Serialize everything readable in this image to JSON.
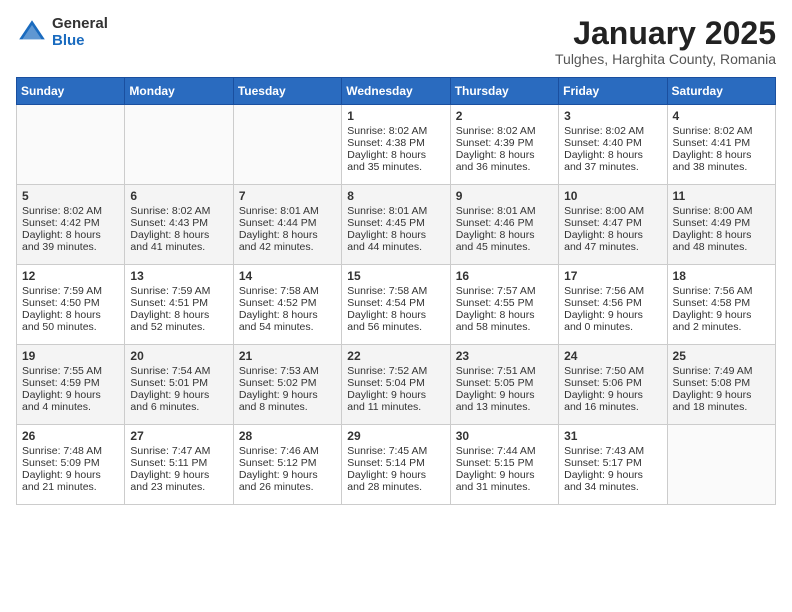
{
  "header": {
    "logo_general": "General",
    "logo_blue": "Blue",
    "title": "January 2025",
    "subtitle": "Tulghes, Harghita County, Romania"
  },
  "days_of_week": [
    "Sunday",
    "Monday",
    "Tuesday",
    "Wednesday",
    "Thursday",
    "Friday",
    "Saturday"
  ],
  "weeks": [
    [
      {
        "day": "",
        "content": ""
      },
      {
        "day": "",
        "content": ""
      },
      {
        "day": "",
        "content": ""
      },
      {
        "day": "1",
        "content": "Sunrise: 8:02 AM\nSunset: 4:38 PM\nDaylight: 8 hours and 35 minutes."
      },
      {
        "day": "2",
        "content": "Sunrise: 8:02 AM\nSunset: 4:39 PM\nDaylight: 8 hours and 36 minutes."
      },
      {
        "day": "3",
        "content": "Sunrise: 8:02 AM\nSunset: 4:40 PM\nDaylight: 8 hours and 37 minutes."
      },
      {
        "day": "4",
        "content": "Sunrise: 8:02 AM\nSunset: 4:41 PM\nDaylight: 8 hours and 38 minutes."
      }
    ],
    [
      {
        "day": "5",
        "content": "Sunrise: 8:02 AM\nSunset: 4:42 PM\nDaylight: 8 hours and 39 minutes."
      },
      {
        "day": "6",
        "content": "Sunrise: 8:02 AM\nSunset: 4:43 PM\nDaylight: 8 hours and 41 minutes."
      },
      {
        "day": "7",
        "content": "Sunrise: 8:01 AM\nSunset: 4:44 PM\nDaylight: 8 hours and 42 minutes."
      },
      {
        "day": "8",
        "content": "Sunrise: 8:01 AM\nSunset: 4:45 PM\nDaylight: 8 hours and 44 minutes."
      },
      {
        "day": "9",
        "content": "Sunrise: 8:01 AM\nSunset: 4:46 PM\nDaylight: 8 hours and 45 minutes."
      },
      {
        "day": "10",
        "content": "Sunrise: 8:00 AM\nSunset: 4:47 PM\nDaylight: 8 hours and 47 minutes."
      },
      {
        "day": "11",
        "content": "Sunrise: 8:00 AM\nSunset: 4:49 PM\nDaylight: 8 hours and 48 minutes."
      }
    ],
    [
      {
        "day": "12",
        "content": "Sunrise: 7:59 AM\nSunset: 4:50 PM\nDaylight: 8 hours and 50 minutes."
      },
      {
        "day": "13",
        "content": "Sunrise: 7:59 AM\nSunset: 4:51 PM\nDaylight: 8 hours and 52 minutes."
      },
      {
        "day": "14",
        "content": "Sunrise: 7:58 AM\nSunset: 4:52 PM\nDaylight: 8 hours and 54 minutes."
      },
      {
        "day": "15",
        "content": "Sunrise: 7:58 AM\nSunset: 4:54 PM\nDaylight: 8 hours and 56 minutes."
      },
      {
        "day": "16",
        "content": "Sunrise: 7:57 AM\nSunset: 4:55 PM\nDaylight: 8 hours and 58 minutes."
      },
      {
        "day": "17",
        "content": "Sunrise: 7:56 AM\nSunset: 4:56 PM\nDaylight: 9 hours and 0 minutes."
      },
      {
        "day": "18",
        "content": "Sunrise: 7:56 AM\nSunset: 4:58 PM\nDaylight: 9 hours and 2 minutes."
      }
    ],
    [
      {
        "day": "19",
        "content": "Sunrise: 7:55 AM\nSunset: 4:59 PM\nDaylight: 9 hours and 4 minutes."
      },
      {
        "day": "20",
        "content": "Sunrise: 7:54 AM\nSunset: 5:01 PM\nDaylight: 9 hours and 6 minutes."
      },
      {
        "day": "21",
        "content": "Sunrise: 7:53 AM\nSunset: 5:02 PM\nDaylight: 9 hours and 8 minutes."
      },
      {
        "day": "22",
        "content": "Sunrise: 7:52 AM\nSunset: 5:04 PM\nDaylight: 9 hours and 11 minutes."
      },
      {
        "day": "23",
        "content": "Sunrise: 7:51 AM\nSunset: 5:05 PM\nDaylight: 9 hours and 13 minutes."
      },
      {
        "day": "24",
        "content": "Sunrise: 7:50 AM\nSunset: 5:06 PM\nDaylight: 9 hours and 16 minutes."
      },
      {
        "day": "25",
        "content": "Sunrise: 7:49 AM\nSunset: 5:08 PM\nDaylight: 9 hours and 18 minutes."
      }
    ],
    [
      {
        "day": "26",
        "content": "Sunrise: 7:48 AM\nSunset: 5:09 PM\nDaylight: 9 hours and 21 minutes."
      },
      {
        "day": "27",
        "content": "Sunrise: 7:47 AM\nSunset: 5:11 PM\nDaylight: 9 hours and 23 minutes."
      },
      {
        "day": "28",
        "content": "Sunrise: 7:46 AM\nSunset: 5:12 PM\nDaylight: 9 hours and 26 minutes."
      },
      {
        "day": "29",
        "content": "Sunrise: 7:45 AM\nSunset: 5:14 PM\nDaylight: 9 hours and 28 minutes."
      },
      {
        "day": "30",
        "content": "Sunrise: 7:44 AM\nSunset: 5:15 PM\nDaylight: 9 hours and 31 minutes."
      },
      {
        "day": "31",
        "content": "Sunrise: 7:43 AM\nSunset: 5:17 PM\nDaylight: 9 hours and 34 minutes."
      },
      {
        "day": "",
        "content": ""
      }
    ]
  ]
}
